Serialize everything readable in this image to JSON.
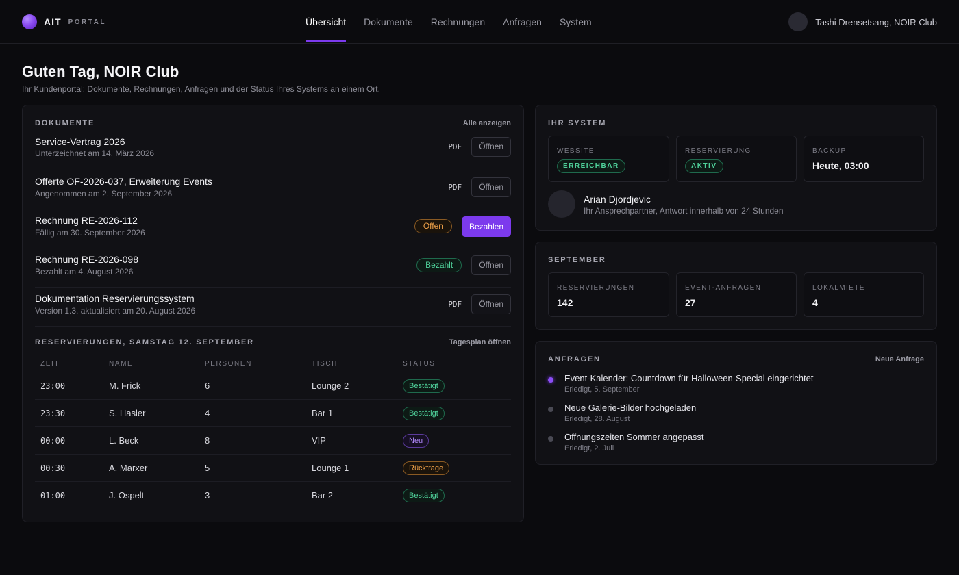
{
  "brand": {
    "name": "AIT",
    "sub": "PORTAL"
  },
  "nav": [
    {
      "label": "Übersicht",
      "active": true
    },
    {
      "label": "Dokumente"
    },
    {
      "label": "Rechnungen"
    },
    {
      "label": "Anfragen"
    },
    {
      "label": "System"
    }
  ],
  "user": {
    "name": "Tashi Drensetsang, NOIR Club"
  },
  "greeting": {
    "title": "Guten Tag, NOIR Club",
    "subtitle": "Ihr Kundenportal: Dokumente, Rechnungen, Anfragen und der Status Ihres Systems an einem Ort."
  },
  "documents": {
    "title": "DOKUMENTE",
    "link": "Alle anzeigen",
    "items": [
      {
        "title": "Service-Vertrag 2026",
        "sub": "Unterzeichnet am 14. März 2026",
        "tag": "PDF",
        "action": "Öffnen"
      },
      {
        "title": "Offerte OF-2026-037, Erweiterung Events",
        "sub": "Angenommen am 2. September 2026",
        "tag": "PDF",
        "action": "Öffnen"
      },
      {
        "title": "Rechnung RE-2026-112",
        "sub": "Fällig am 30. September 2026",
        "status": "Offen",
        "action": "Bezahlen"
      },
      {
        "title": "Rechnung RE-2026-098",
        "sub": "Bezahlt am 4. August 2026",
        "status": "Bezahlt",
        "action": "Öffnen"
      },
      {
        "title": "Dokumentation Reservierungssystem",
        "sub": "Version 1.3, aktualisiert am 20. August 2026",
        "tag": "PDF",
        "action": "Öffnen"
      }
    ]
  },
  "reservations": {
    "title": "RESERVIERUNGEN, SAMSTAG 12. SEPTEMBER",
    "link": "Tagesplan öffnen",
    "headers": [
      "ZEIT",
      "NAME",
      "PERSONEN",
      "TISCH",
      "STATUS"
    ],
    "rows": [
      {
        "time": "23:00",
        "name": "M. Frick",
        "persons": "6",
        "table": "Lounge 2",
        "status": "Bestätigt"
      },
      {
        "time": "23:30",
        "name": "S. Hasler",
        "persons": "4",
        "table": "Bar 1",
        "status": "Bestätigt"
      },
      {
        "time": "00:00",
        "name": "L. Beck",
        "persons": "8",
        "table": "VIP",
        "status": "Neu"
      },
      {
        "time": "00:30",
        "name": "A. Marxer",
        "persons": "5",
        "table": "Lounge 1",
        "status": "Rückfrage"
      },
      {
        "time": "01:00",
        "name": "J. Ospelt",
        "persons": "3",
        "table": "Bar 2",
        "status": "Bestätigt"
      }
    ]
  },
  "system": {
    "title": "IHR SYSTEM",
    "tiles": [
      {
        "label": "WEBSITE",
        "badge": "ERREICHBAR"
      },
      {
        "label": "RESERVIERUNG",
        "badge": "AKTIV"
      },
      {
        "label": "BACKUP",
        "value": "Heute, 03:00"
      }
    ],
    "contact": {
      "name": "Arian Djordjevic",
      "sub": "Ihr Ansprechpartner, Antwort innerhalb von 24 Stunden"
    }
  },
  "month": {
    "title": "SEPTEMBER",
    "tiles": [
      {
        "label": "RESERVIERUNGEN",
        "value": "142"
      },
      {
        "label": "EVENT-ANFRAGEN",
        "value": "27"
      },
      {
        "label": "LOKALMIETE",
        "value": "4"
      }
    ]
  },
  "requests": {
    "title": "ANFRAGEN",
    "link": "Neue Anfrage",
    "items": [
      {
        "title": "Event-Kalender: Countdown für Halloween-Special eingerichtet",
        "sub": "Erledigt, 5. September"
      },
      {
        "title": "Neue Galerie-Bilder hochgeladen",
        "sub": "Erledigt, 28. August"
      },
      {
        "title": "Öffnungszeiten Sommer angepasst",
        "sub": "Erledigt, 2. Juli"
      }
    ]
  },
  "colors": {
    "accent": "#7c3aed",
    "success": "#4fd19a",
    "warning": "#f0a24a",
    "background": "#0b0b0e"
  }
}
